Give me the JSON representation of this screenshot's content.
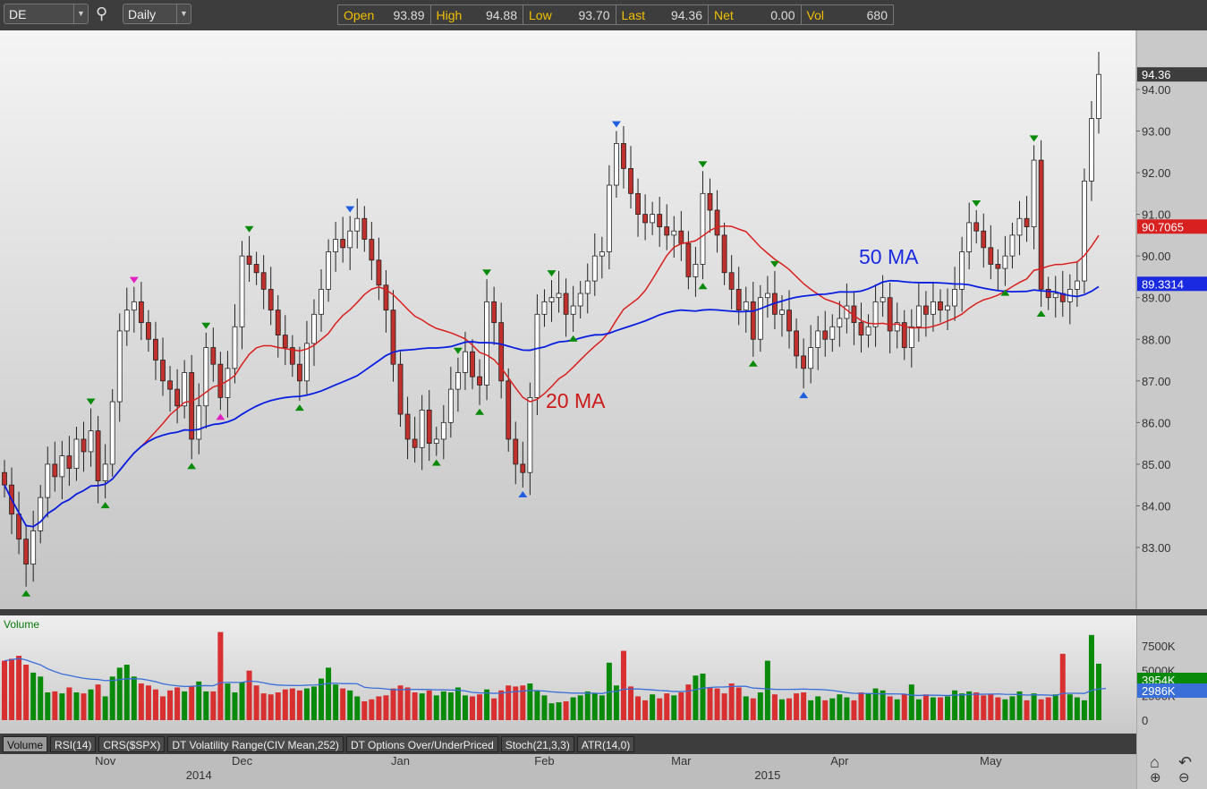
{
  "toolbar": {
    "symbol": "DE",
    "interval": "Daily"
  },
  "quote": {
    "open_label": "Open",
    "open": "93.89",
    "high_label": "High",
    "high": "94.88",
    "low_label": "Low",
    "low": "93.70",
    "last_label": "Last",
    "last": "94.36",
    "net_label": "Net",
    "net": "0.00",
    "vol_label": "Vol",
    "vol": "680"
  },
  "colors": {
    "up_body": "#ffffff",
    "down_body": "#c0302c",
    "ma20": "#d82020",
    "ma50": "#0a1ee0",
    "vol_up": "#0a8a0a",
    "vol_down": "#d83030",
    "vol_ma": "#3a6ed8"
  },
  "price_axis": {
    "ticks": [
      "83.00",
      "84.00",
      "85.00",
      "86.00",
      "87.00",
      "88.00",
      "89.00",
      "90.00",
      "91.00",
      "92.00",
      "93.00",
      "94.00"
    ],
    "last_label": "94.36",
    "ma20_label": "90.7065",
    "ma50_label": "89.3314"
  },
  "volume_axis": {
    "title": "Volume",
    "ticks": [
      "0",
      "2500K",
      "5000K",
      "7500K"
    ],
    "last_label": "3954K",
    "ma_label": "2986K"
  },
  "annotations": {
    "ma20": "20 MA",
    "ma50": "50 MA"
  },
  "tabs": [
    "Volume",
    "RSI(14)",
    "CRS($SPX)",
    "DT Volatility Range(CIV Mean,252)",
    "DT Options Over/UnderPriced",
    "Stoch(21,3,3)",
    "ATR(14,0)"
  ],
  "months": [
    {
      "label": "Nov",
      "i": 14
    },
    {
      "label": "Dec",
      "i": 33
    },
    {
      "label": "Jan",
      "i": 55
    },
    {
      "label": "Feb",
      "i": 75
    },
    {
      "label": "Mar",
      "i": 94
    },
    {
      "label": "Apr",
      "i": 116
    },
    {
      "label": "May",
      "i": 137
    }
  ],
  "years": [
    {
      "label": "2014",
      "i": 27
    },
    {
      "label": "2015",
      "i": 106
    }
  ],
  "chart_data": {
    "type": "candlestick",
    "ylim": [
      82,
      95
    ],
    "closes": [
      84.5,
      83.8,
      83.2,
      82.6,
      83.4,
      84.2,
      85.0,
      84.7,
      85.2,
      84.9,
      85.6,
      85.3,
      85.8,
      84.6,
      85.0,
      86.5,
      88.2,
      88.7,
      88.9,
      88.4,
      88.0,
      87.5,
      87.0,
      86.8,
      86.4,
      87.2,
      85.6,
      86.4,
      87.8,
      87.4,
      86.6,
      87.3,
      88.3,
      90.0,
      89.8,
      89.6,
      89.2,
      88.7,
      88.1,
      87.8,
      87.4,
      87.0,
      87.9,
      88.6,
      89.2,
      90.1,
      90.4,
      90.2,
      90.6,
      90.9,
      90.4,
      89.9,
      89.3,
      88.7,
      87.4,
      86.2,
      85.6,
      85.4,
      86.3,
      85.5,
      85.6,
      86.0,
      86.8,
      87.2,
      87.7,
      87.1,
      86.9,
      88.9,
      88.4,
      87.0,
      85.6,
      85.0,
      84.8,
      86.6,
      88.6,
      88.9,
      89.0,
      89.1,
      88.6,
      88.8,
      89.1,
      89.4,
      90.0,
      90.1,
      91.7,
      92.7,
      92.1,
      91.5,
      91.0,
      90.8,
      91.0,
      90.7,
      90.5,
      90.6,
      90.3,
      89.5,
      89.8,
      91.5,
      91.1,
      90.5,
      89.6,
      89.2,
      88.7,
      88.9,
      88.0,
      89.0,
      89.1,
      88.6,
      88.7,
      88.2,
      87.6,
      87.3,
      87.8,
      88.2,
      88.0,
      88.3,
      88.5,
      88.8,
      88.4,
      88.1,
      88.3,
      88.9,
      89.0,
      88.2,
      88.4,
      87.8,
      88.3,
      88.8,
      88.6,
      88.9,
      88.7,
      88.8,
      89.2,
      90.1,
      90.8,
      90.6,
      90.2,
      89.8,
      89.7,
      90.0,
      90.5,
      90.9,
      90.7,
      92.3,
      89.2,
      89.0,
      89.1,
      88.9,
      89.2,
      89.4,
      91.8,
      93.3,
      94.36
    ],
    "volumes_k": [
      6000,
      6200,
      6500,
      5600,
      4800,
      4400,
      2800,
      2900,
      2700,
      3300,
      2800,
      2700,
      3100,
      3600,
      2400,
      4400,
      5300,
      5600,
      4400,
      3700,
      3500,
      3100,
      2400,
      3000,
      3300,
      2900,
      3400,
      3900,
      2900,
      2900,
      8900,
      3700,
      2800,
      3800,
      5000,
      3500,
      2700,
      2600,
      2800,
      3100,
      3200,
      3000,
      3200,
      3400,
      4200,
      5300,
      3600,
      3200,
      3000,
      2400,
      1900,
      2100,
      2400,
      2500,
      3200,
      3500,
      3300,
      2800,
      2700,
      3000,
      2500,
      2900,
      2800,
      3300,
      2500,
      2400,
      2600,
      3100,
      2200,
      3000,
      3500,
      3400,
      3500,
      3700,
      3000,
      2500,
      1700,
      1800,
      1900,
      2300,
      2500,
      2900,
      2700,
      2500,
      5800,
      3500,
      7000,
      3400,
      2400,
      2000,
      2600,
      2200,
      2700,
      2500,
      2800,
      3600,
      4500,
      4700,
      3300,
      3200,
      2700,
      3700,
      3300,
      2400,
      2200,
      2800,
      6000,
      2600,
      2100,
      2200,
      2700,
      2800,
      2000,
      2400,
      2000,
      2200,
      2600,
      2300,
      2000,
      2800,
      2700,
      3200,
      3000,
      2400,
      2100,
      2600,
      3600,
      2100,
      2600,
      2300,
      2300,
      2400,
      3000,
      2700,
      2900,
      2800,
      2500,
      2600,
      2300,
      2100,
      2400,
      2900,
      2000,
      2700,
      2100,
      2300,
      2600,
      6700,
      2600,
      2300,
      2000,
      8600,
      5700,
      3954
    ],
    "markers": [
      {
        "i": 3,
        "type": "low",
        "color": "#0a8a0a"
      },
      {
        "i": 12,
        "type": "high",
        "color": "#0a8a0a"
      },
      {
        "i": 14,
        "type": "low",
        "color": "#0a8a0a"
      },
      {
        "i": 18,
        "type": "high",
        "color": "#e020c0"
      },
      {
        "i": 26,
        "type": "low",
        "color": "#0a8a0a"
      },
      {
        "i": 28,
        "type": "high",
        "color": "#0a8a0a"
      },
      {
        "i": 30,
        "type": "low",
        "color": "#e020c0"
      },
      {
        "i": 34,
        "type": "high",
        "color": "#0a8a0a"
      },
      {
        "i": 41,
        "type": "low",
        "color": "#0a8a0a"
      },
      {
        "i": 48,
        "type": "high",
        "color": "#2060e0"
      },
      {
        "i": 60,
        "type": "low",
        "color": "#0a8a0a"
      },
      {
        "i": 63,
        "type": "high",
        "color": "#0a8a0a"
      },
      {
        "i": 66,
        "type": "low",
        "color": "#0a8a0a"
      },
      {
        "i": 67,
        "type": "high",
        "color": "#0a8a0a"
      },
      {
        "i": 72,
        "type": "low",
        "color": "#2060e0"
      },
      {
        "i": 76,
        "type": "high",
        "color": "#0a8a0a"
      },
      {
        "i": 79,
        "type": "low",
        "color": "#0a8a0a"
      },
      {
        "i": 85,
        "type": "high",
        "color": "#2060e0"
      },
      {
        "i": 97,
        "type": "high",
        "color": "#0a8a0a"
      },
      {
        "i": 97,
        "type": "low",
        "color": "#0a8a0a"
      },
      {
        "i": 104,
        "type": "low",
        "color": "#0a8a0a"
      },
      {
        "i": 107,
        "type": "high",
        "color": "#0a8a0a"
      },
      {
        "i": 111,
        "type": "low",
        "color": "#2060e0"
      },
      {
        "i": 135,
        "type": "high",
        "color": "#0a8a0a"
      },
      {
        "i": 139,
        "type": "low",
        "color": "#0a8a0a"
      },
      {
        "i": 143,
        "type": "high",
        "color": "#0a8a0a"
      },
      {
        "i": 144,
        "type": "low",
        "color": "#0a8a0a"
      }
    ]
  }
}
